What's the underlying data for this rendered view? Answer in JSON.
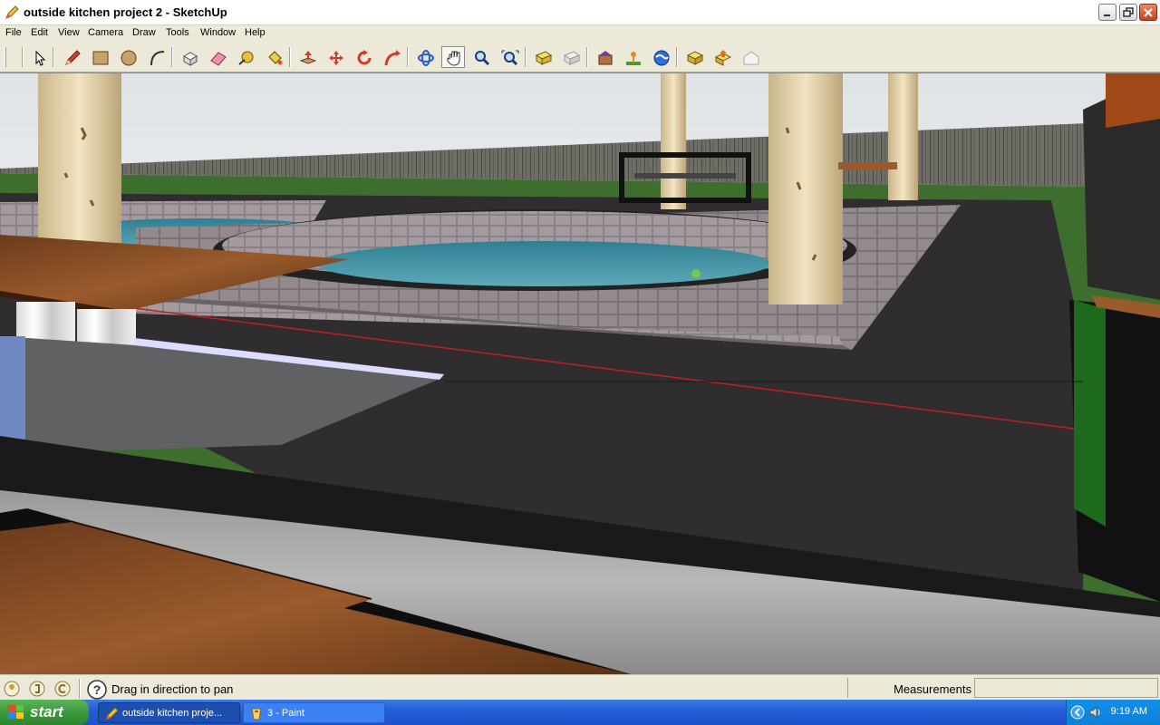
{
  "window": {
    "title": "outside kitchen project 2 - SketchUp",
    "icon": "sketchup-pencil-icon",
    "controls": [
      "minimize-icon",
      "restore-icon",
      "close-icon"
    ]
  },
  "menu": {
    "items": [
      "File",
      "Edit",
      "View",
      "Camera",
      "Draw",
      "Tools",
      "Window",
      "Help"
    ]
  },
  "toolbar": {
    "tools": [
      {
        "name": "select-tool",
        "icon": "arrow-cursor-icon"
      },
      {
        "name": "line-tool",
        "icon": "pencil-icon"
      },
      {
        "name": "rectangle-tool",
        "icon": "rectangle-icon"
      },
      {
        "name": "circle-tool",
        "icon": "circle-icon"
      },
      {
        "name": "arc-tool",
        "icon": "arc-icon"
      },
      {
        "name": "make-component-tool",
        "icon": "component-icon"
      },
      {
        "name": "eraser-tool",
        "icon": "eraser-icon"
      },
      {
        "name": "tape-measure-tool",
        "icon": "tape-measure-icon"
      },
      {
        "name": "paint-bucket-tool",
        "icon": "paint-bucket-icon"
      },
      {
        "name": "push-pull-tool",
        "icon": "push-pull-icon"
      },
      {
        "name": "move-tool",
        "icon": "move-icon"
      },
      {
        "name": "rotate-tool",
        "icon": "rotate-icon"
      },
      {
        "name": "follow-me-tool",
        "icon": "follow-me-icon"
      },
      {
        "name": "orbit-tool",
        "icon": "orbit-icon"
      },
      {
        "name": "pan-tool",
        "icon": "hand-icon",
        "pressed": true
      },
      {
        "name": "zoom-tool",
        "icon": "magnifier-icon"
      },
      {
        "name": "zoom-extents-tool",
        "icon": "zoom-extents-icon"
      },
      {
        "name": "previous-view-tool",
        "icon": "previous-view-icon"
      },
      {
        "name": "next-view-tool",
        "icon": "next-view-icon"
      },
      {
        "name": "3d-warehouse-tool",
        "icon": "warehouse-icon"
      },
      {
        "name": "add-location-tool",
        "icon": "location-icon"
      },
      {
        "name": "google-earth-tool",
        "icon": "earth-icon"
      },
      {
        "name": "get-models-tool",
        "icon": "get-models-icon"
      },
      {
        "name": "share-model-tool",
        "icon": "share-model-icon"
      },
      {
        "name": "component-share-tool",
        "icon": "house-icon"
      }
    ]
  },
  "statusbar": {
    "hint": "Drag in direction to pan",
    "measurements_label": "Measurements",
    "measurements_value": "",
    "icons": [
      "geo-location-icon",
      "credits-icon",
      "info-icon",
      "help-icon"
    ]
  },
  "taskbar": {
    "start_label": "start",
    "tasks": [
      {
        "label": "outside kitchen proje...",
        "icon": "sketchup-pencil-icon",
        "active": true
      },
      {
        "label": "3 - Paint",
        "icon": "paint-icon",
        "active": false
      }
    ],
    "tray_icons": [
      "chevron-left-icon",
      "speaker-icon"
    ],
    "clock": "9:19 AM"
  }
}
